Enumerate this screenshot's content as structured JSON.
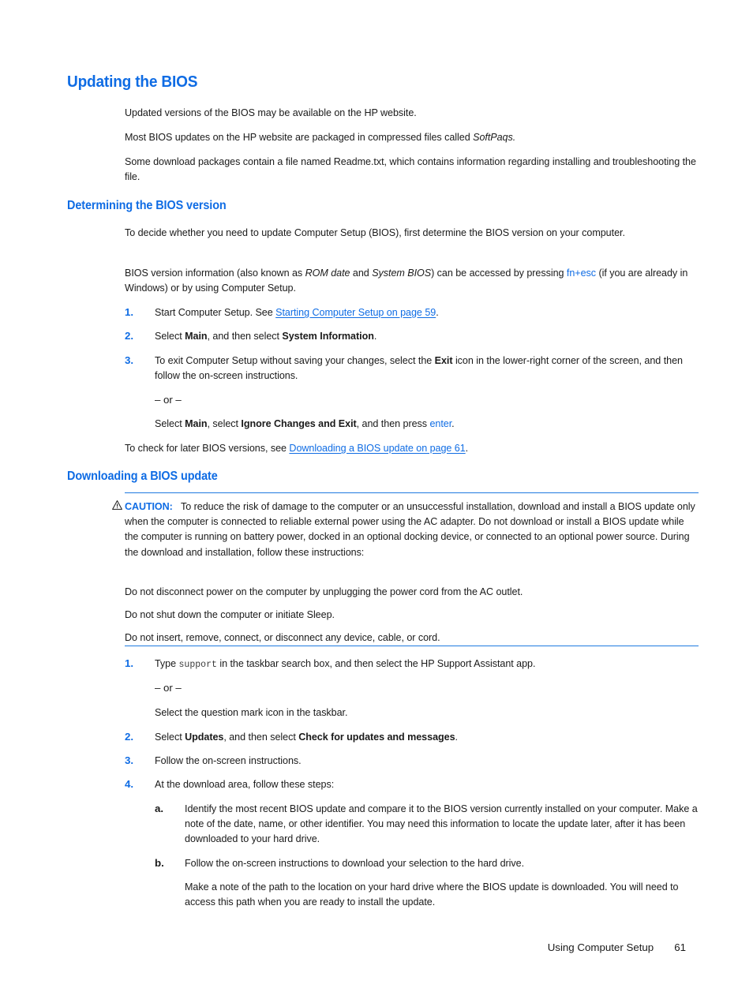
{
  "page": {
    "heading": "Updating the BIOS",
    "accent_color": "#0f6ce4",
    "text_color": "#1a1a1a",
    "background": "#ffffff"
  },
  "intro": {
    "p1": "Updated versions of the BIOS may be available on the HP website.",
    "p2_before": "Most BIOS updates on the HP website are packaged in compressed files called ",
    "p2_italic": "SoftPaqs.",
    "p3": "Some download packages contain a file named Readme.txt, which contains information regarding installing and troubleshooting the file."
  },
  "determining": {
    "heading": "Determining the BIOS version",
    "p1": "To decide whether you need to update Computer Setup (BIOS), first determine the BIOS version on your computer.",
    "p2_a": "BIOS version information (also known as ",
    "p2_i1": "ROM date",
    "p2_b": " and ",
    "p2_i2": "System BIOS",
    "p2_c": ") can be accessed by pressing ",
    "p2_key1": "fn",
    "p2_plus": "+",
    "p2_key2": "esc",
    "p2_d": " (if you are already in Windows) or by using Computer Setup.",
    "steps": [
      {
        "marker": "1.",
        "text_a": "Start Computer Setup. See ",
        "link": "Starting Computer Setup on page 59",
        "text_b": "."
      },
      {
        "marker": "2.",
        "text_a": "Select ",
        "bold1": "Main",
        "text_b": ", and then select ",
        "bold2": "System Information",
        "text_c": "."
      },
      {
        "marker": "3.",
        "text_a": "To exit Computer Setup without saving your changes, select the ",
        "bold1": "Exit",
        "text_b": " icon in the lower-right corner of the screen, and then follow the on-screen instructions."
      }
    ],
    "or_label": "– or –",
    "alt_a": "Select ",
    "alt_bold1": "Main",
    "alt_b": ", select ",
    "alt_bold2": "Ignore Changes and Exit",
    "alt_c": ", and then press ",
    "alt_key": "enter",
    "alt_d": ".",
    "closing_a": "To check for later BIOS versions, see ",
    "closing_link": "Downloading a BIOS update on page 61",
    "closing_b": "."
  },
  "downloading": {
    "heading": "Downloading a BIOS update",
    "caution": {
      "icon": "warning-triangle-icon",
      "label": "CAUTION:",
      "body": "To reduce the risk of damage to the computer or an unsuccessful installation, download and install a BIOS update only when the computer is connected to reliable external power using the AC adapter. Do not download or install a BIOS update while the computer is running on battery power, docked in an optional docking device, or connected to an optional power source. During the download and installation, follow these instructions:",
      "b1": "Do not disconnect power on the computer by unplugging the power cord from the AC outlet.",
      "b2": "Do not shut down the computer or initiate Sleep.",
      "b3": "Do not insert, remove, connect, or disconnect any device, cable, or cord."
    },
    "steps": [
      {
        "marker": "1.",
        "text_a": "Type ",
        "mono": "support",
        "text_b": " in the taskbar search box, and then select the HP Support Assistant app."
      },
      {
        "marker": "2.",
        "text_a": "Select ",
        "bold1": "Updates",
        "text_b": ", and then select ",
        "bold2": "Check for updates and messages",
        "text_c": "."
      },
      {
        "marker": "3.",
        "text_a": "Follow the on-screen instructions."
      },
      {
        "marker": "4.",
        "text_a": "At the download area, follow these steps:"
      }
    ],
    "or_label": "– or –",
    "alt_text": "Select the question mark icon in the taskbar.",
    "substeps": [
      {
        "marker": "a.",
        "text": "Identify the most recent BIOS update and compare it to the BIOS version currently installed on your computer. Make a note of the date, name, or other identifier. You may need this information to locate the update later, after it has been downloaded to your hard drive."
      },
      {
        "marker": "b.",
        "text": "Follow the on-screen instructions to download your selection to the hard drive."
      }
    ],
    "substep_note": "Make a note of the path to the location on your hard drive where the BIOS update is downloaded. You will need to access this path when you are ready to install the update."
  },
  "footer": {
    "section": "Using Computer Setup",
    "page_number": "61"
  }
}
